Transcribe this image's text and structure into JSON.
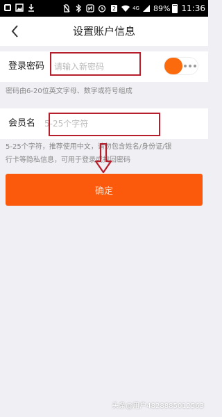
{
  "status_bar": {
    "time": "11:36",
    "battery": "89%",
    "network": "4G"
  },
  "header": {
    "title": "设置账户信息"
  },
  "password_row": {
    "label": "登录密码",
    "placeholder": "请输入新密码",
    "hint": "密码由6-20位英文字母、数字或符号组成"
  },
  "member_row": {
    "label": "会员名",
    "placeholder": "5-25个字符",
    "hint_line1": "5-25个字符，推荐使用中文，请勿包含姓名/身份证/银",
    "hint_line2": "行卡等隐私信息，可用于登录或找回密码"
  },
  "confirm_button": {
    "label": "确定"
  },
  "watermark": "头条@用户4828885012563",
  "colors": {
    "accent": "#fb5a0c",
    "highlight_box": "#b51e2a"
  }
}
